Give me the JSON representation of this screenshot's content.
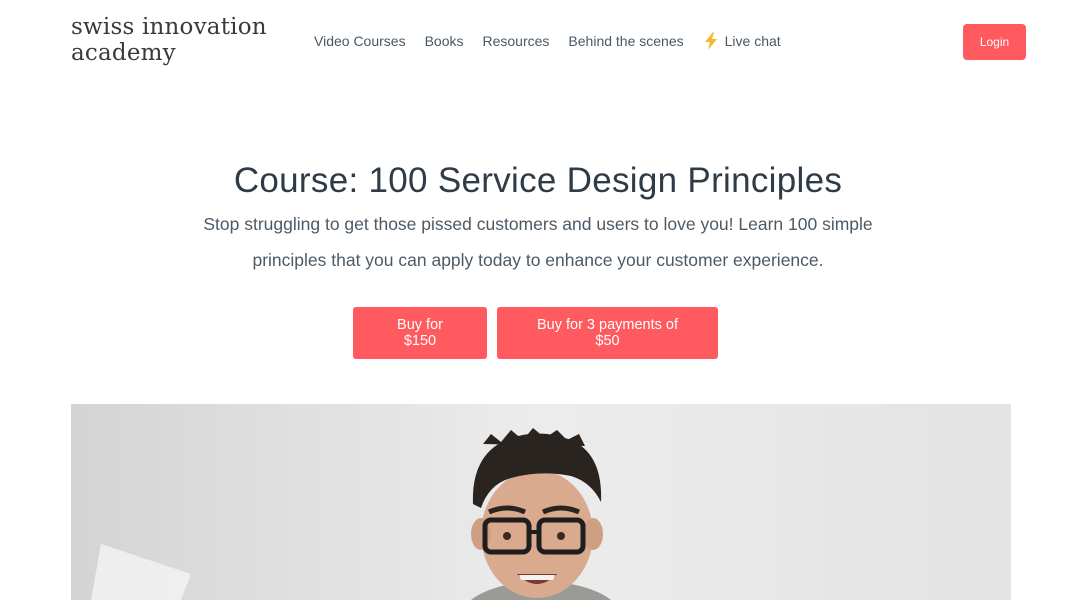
{
  "brand": {
    "line1": "swiss innovation",
    "line2": "academy"
  },
  "nav": {
    "items": [
      {
        "label": "Video Courses"
      },
      {
        "label": "Books"
      },
      {
        "label": "Resources"
      },
      {
        "label": "Behind the scenes"
      },
      {
        "label": "Live chat",
        "icon": "lightning-bolt-icon"
      }
    ],
    "login_label": "Login"
  },
  "hero": {
    "title": "Course: 100 Service Design Principles",
    "subtitle": "Stop struggling to get those pissed customers and users to love you! Learn 100 simple principles that you can apply today to enhance your customer experience."
  },
  "cta": {
    "buy_full": "Buy for $150",
    "buy_installments": "Buy for 3 payments of $50"
  },
  "colors": {
    "accent": "#ff5a5f",
    "bolt": "#f5b82e",
    "heading": "#2f3c47",
    "text": "#4d5a65"
  },
  "media": {
    "icon": "course-video-thumbnail"
  }
}
